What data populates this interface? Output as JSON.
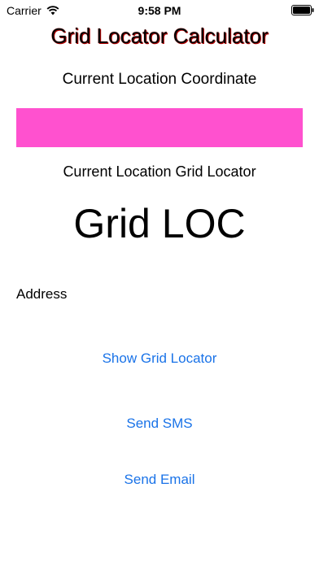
{
  "status_bar": {
    "carrier": "Carrier",
    "time": "9:58 PM",
    "wifi_icon": "wifi-icon",
    "battery_icon": "battery-icon"
  },
  "app": {
    "title": "Grid Locator Calculator",
    "title_color": "#000000",
    "title_shadow_color": "#c00000"
  },
  "location": {
    "coordinate_label": "Current Location Coordinate",
    "coordinate_value": "",
    "coordinate_box_color": "#ff51cf",
    "grid_locator_label": "Current Location Grid Locator",
    "grid_locator_value": "Grid LOC",
    "address_label": "Address"
  },
  "actions": {
    "show_grid_locator": "Show Grid Locator",
    "send_sms": "Send SMS",
    "send_email": "Send Email",
    "link_color": "#1a73e8"
  }
}
